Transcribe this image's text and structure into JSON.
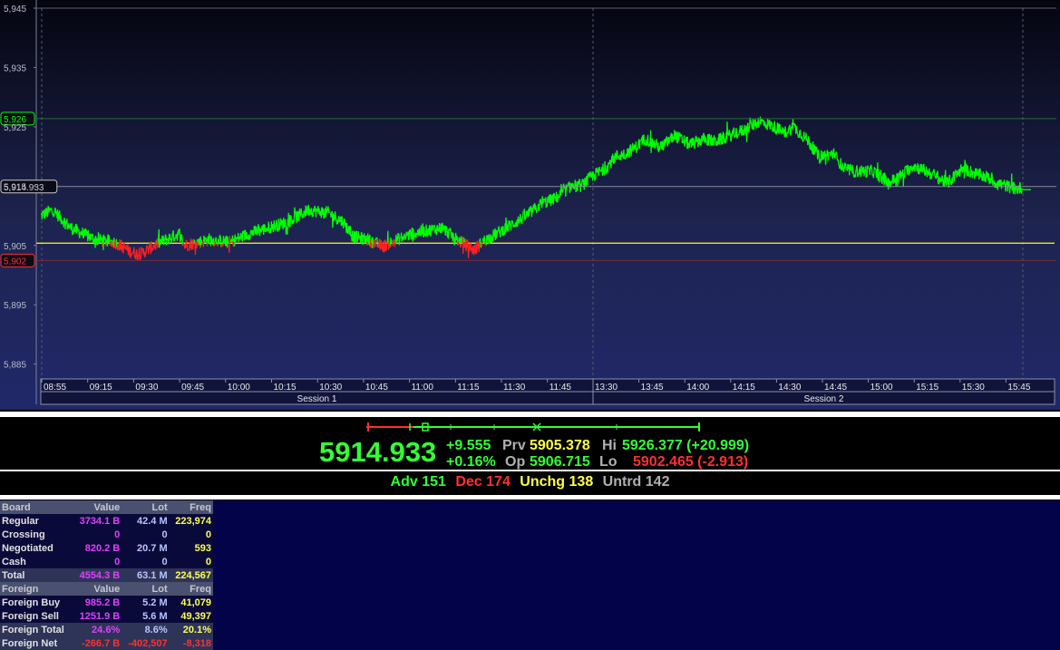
{
  "chart": {
    "y_ticks": [
      {
        "label": "5,945",
        "value": 5945
      },
      {
        "label": "5,935",
        "value": 5935
      },
      {
        "label": "5,925",
        "value": 5925
      },
      {
        "label": "5,915",
        "value": 5915
      },
      {
        "label": "5,905",
        "value": 5905
      },
      {
        "label": "5,895",
        "value": 5895
      },
      {
        "label": "5,885",
        "value": 5885
      }
    ],
    "y_min": 5882.5,
    "y_max": 5945,
    "markers": [
      {
        "label": "5,926",
        "value": 5926.377,
        "color": "#00ff00",
        "line": "#2a6a3a"
      },
      {
        "label": "5,914.933",
        "value": 5914.933,
        "color": "#c8c8c8",
        "line": "#8a8a9a"
      },
      {
        "label": "5,902",
        "value": 5902.465,
        "color": "#ff3030",
        "line": "#7a2a3a"
      }
    ],
    "prev_close": 5905.378,
    "time_labels": [
      "08:55",
      "09:15",
      "09:30",
      "09:45",
      "10:00",
      "10:15",
      "10:30",
      "10:45",
      "11:00",
      "11:15",
      "11:30",
      "11:45",
      "13:30",
      "13:45",
      "14:00",
      "14:15",
      "14:30",
      "14:45",
      "15:00",
      "15:15",
      "15:30",
      "15:45"
    ],
    "sessions": [
      "Session 1",
      "Session 2"
    ],
    "colors": {
      "up": "#00ff00",
      "down": "#ff2020",
      "prev_line": "#ffff00"
    },
    "waypoints": [
      [
        0,
        5910
      ],
      [
        0.012,
        5911
      ],
      [
        0.03,
        5908
      ],
      [
        0.055,
        5906
      ],
      [
        0.075,
        5905.5
      ],
      [
        0.09,
        5904
      ],
      [
        0.1,
        5903.5
      ],
      [
        0.11,
        5904.5
      ],
      [
        0.12,
        5905.5
      ],
      [
        0.14,
        5907
      ],
      [
        0.145,
        5905
      ],
      [
        0.17,
        5906
      ],
      [
        0.19,
        5905.5
      ],
      [
        0.21,
        5907
      ],
      [
        0.23,
        5908
      ],
      [
        0.25,
        5909
      ],
      [
        0.27,
        5911
      ],
      [
        0.29,
        5910.5
      ],
      [
        0.305,
        5909
      ],
      [
        0.315,
        5906.5
      ],
      [
        0.33,
        5906
      ],
      [
        0.345,
        5904.8
      ],
      [
        0.36,
        5906
      ],
      [
        0.375,
        5907
      ],
      [
        0.39,
        5907.5
      ],
      [
        0.405,
        5908
      ],
      [
        0.42,
        5906
      ],
      [
        0.43,
        5905
      ],
      [
        0.438,
        5904.2
      ],
      [
        0.445,
        5905.5
      ],
      [
        0.46,
        5907
      ],
      [
        0.475,
        5908.5
      ],
      [
        0.49,
        5910
      ],
      [
        0.505,
        5912
      ],
      [
        0.52,
        5913
      ],
      [
        0.535,
        5915
      ],
      [
        0.545,
        5915
      ],
      [
        0.555,
        5916.5
      ],
      [
        0.57,
        5918
      ],
      [
        0.58,
        5920
      ],
      [
        0.59,
        5920.5
      ],
      [
        0.6,
        5921.5
      ],
      [
        0.61,
        5923
      ],
      [
        0.625,
        5921.5
      ],
      [
        0.64,
        5923.5
      ],
      [
        0.655,
        5922
      ],
      [
        0.67,
        5923
      ],
      [
        0.68,
        5922.5
      ],
      [
        0.695,
        5923.5
      ],
      [
        0.71,
        5924.5
      ],
      [
        0.725,
        5926
      ],
      [
        0.74,
        5925
      ],
      [
        0.75,
        5924
      ],
      [
        0.76,
        5925
      ],
      [
        0.775,
        5922.5
      ],
      [
        0.785,
        5920
      ],
      [
        0.8,
        5920.5
      ],
      [
        0.81,
        5918
      ],
      [
        0.82,
        5917.5
      ],
      [
        0.84,
        5917.5
      ],
      [
        0.855,
        5915.5
      ],
      [
        0.87,
        5917
      ],
      [
        0.88,
        5918.5
      ],
      [
        0.9,
        5917
      ],
      [
        0.915,
        5915.5
      ],
      [
        0.93,
        5918
      ],
      [
        0.945,
        5917
      ],
      [
        0.955,
        5916.5
      ],
      [
        0.965,
        5915.5
      ],
      [
        0.975,
        5915
      ],
      [
        0.985,
        5914.5
      ],
      [
        0.99,
        5914.8
      ]
    ]
  },
  "progress_bar": {
    "colors": {
      "left": "#ff3030",
      "right": "#33ff33"
    }
  },
  "summary": {
    "last": "5914.933",
    "change": "+9.555",
    "change_pct": "+0.16%",
    "prv_label": "Prv",
    "prv_value": "5905.378",
    "op_label": "Op",
    "op_value": "5906.715",
    "hi_label": "Hi",
    "hi_value": "5926.377 (+20.999)",
    "lo_label": "Lo",
    "lo_value": "5902.465 (-2.913)"
  },
  "breadth": {
    "adv": "Adv 151",
    "dec": "Dec 174",
    "unchg": "Unchg 138",
    "untrd": "Untrd 142"
  },
  "board": {
    "headers": [
      "Board",
      "Value",
      "Lot",
      "Freq"
    ],
    "rows": [
      {
        "label": "Regular",
        "value": "3734.1 B",
        "lot": "42.4 M",
        "freq": "223,974"
      },
      {
        "label": "Crossing",
        "value": "0",
        "lot": "0",
        "freq": "0"
      },
      {
        "label": "Negotiated",
        "value": "820.2 B",
        "lot": "20.7 M",
        "freq": "593"
      },
      {
        "label": "Cash",
        "value": "0",
        "lot": "0",
        "freq": "0"
      }
    ],
    "total": {
      "label": "Total",
      "value": "4554.3 B",
      "lot": "63.1 M",
      "freq": "224,567"
    }
  },
  "foreign": {
    "headers": [
      "Foreign",
      "Value",
      "Lot",
      "Freq"
    ],
    "buy": {
      "label": "Foreign Buy",
      "value": "985.2 B",
      "lot": "5.2 M",
      "freq": "41,079"
    },
    "sell": {
      "label": "Foreign Sell",
      "value": "1251.9 B",
      "lot": "5.6 M",
      "freq": "49,397"
    },
    "total": {
      "label": "Foreign Total",
      "value": "24.6%",
      "lot": "8.6%",
      "freq": "20.1%"
    },
    "net": {
      "label": "Foreign Net",
      "value": "-266.7 B",
      "lot": "-402,507",
      "freq": "-8,318"
    }
  }
}
